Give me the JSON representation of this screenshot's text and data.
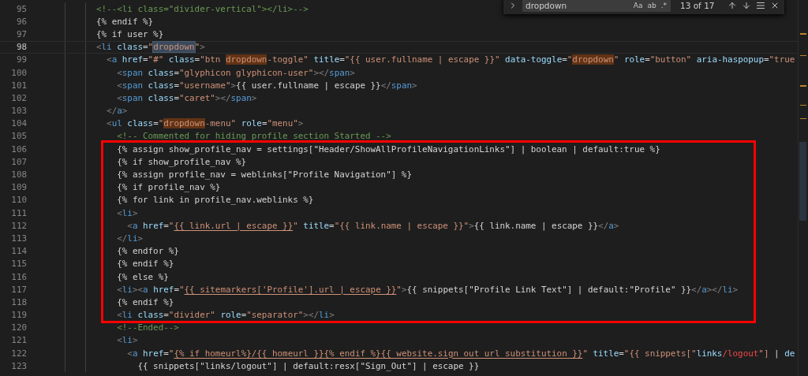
{
  "find_widget": {
    "query": "dropdown",
    "options": [
      {
        "label": "Aa",
        "on": false
      },
      {
        "label": "ab",
        "on": false
      },
      {
        "label": ".*",
        "on": false
      }
    ],
    "result": "13 of 17"
  },
  "lines": [
    {
      "number": "95",
      "current": false,
      "tokens": [
        {
          "kind": "cmt",
          "text": "<!--<li class=\"divider-vertical\"></li>-->"
        }
      ]
    },
    {
      "number": "96",
      "current": false,
      "tokens": [
        {
          "kind": "txt",
          "text": "{% endif %}"
        }
      ]
    },
    {
      "number": "97",
      "current": false,
      "tokens": [
        {
          "kind": "txt",
          "text": "{% if user %}"
        }
      ]
    },
    {
      "number": "98",
      "current": true,
      "tokens": [
        {
          "kind": "p",
          "text": "<"
        },
        {
          "kind": "tag",
          "text": "li"
        },
        {
          "kind": "attr",
          "text": " class"
        },
        {
          "kind": "txt",
          "text": "="
        },
        {
          "kind": "str",
          "text": "\""
        },
        {
          "kind": "cur",
          "text": "dropdown"
        },
        {
          "kind": "str",
          "text": "\""
        },
        {
          "kind": "p",
          "text": ">"
        }
      ]
    },
    {
      "number": "99",
      "current": false,
      "tokens": [
        {
          "kind": "p",
          "text": "  <"
        },
        {
          "kind": "tag",
          "text": "a"
        },
        {
          "kind": "attr",
          "text": " href"
        },
        {
          "kind": "txt",
          "text": "="
        },
        {
          "kind": "str",
          "text": "\"#\""
        },
        {
          "kind": "attr",
          "text": " class"
        },
        {
          "kind": "txt",
          "text": "="
        },
        {
          "kind": "str",
          "text": "\"btn "
        },
        {
          "kind": "hit",
          "text": "dropdown"
        },
        {
          "kind": "str",
          "text": "-toggle\""
        },
        {
          "kind": "attr",
          "text": " title"
        },
        {
          "kind": "txt",
          "text": "="
        },
        {
          "kind": "str",
          "text": "\"{{ user.fullname | escape }}\""
        },
        {
          "kind": "attr",
          "text": " data-toggle"
        },
        {
          "kind": "txt",
          "text": "="
        },
        {
          "kind": "str",
          "text": "\""
        },
        {
          "kind": "hit",
          "text": "dropdown"
        },
        {
          "kind": "str",
          "text": "\""
        },
        {
          "kind": "attr",
          "text": " role"
        },
        {
          "kind": "txt",
          "text": "="
        },
        {
          "kind": "str",
          "text": "\"button\""
        },
        {
          "kind": "attr",
          "text": " aria-haspopup"
        },
        {
          "kind": "txt",
          "text": "="
        },
        {
          "kind": "str",
          "text": "\"true"
        }
      ]
    },
    {
      "number": "100",
      "current": false,
      "tokens": [
        {
          "kind": "p",
          "text": "    <"
        },
        {
          "kind": "tag",
          "text": "span"
        },
        {
          "kind": "attr",
          "text": " class"
        },
        {
          "kind": "txt",
          "text": "="
        },
        {
          "kind": "str",
          "text": "\"glyphicon glyphicon-user\""
        },
        {
          "kind": "p",
          "text": "></"
        },
        {
          "kind": "tag",
          "text": "span"
        },
        {
          "kind": "p",
          "text": ">"
        }
      ]
    },
    {
      "number": "101",
      "current": false,
      "tokens": [
        {
          "kind": "p",
          "text": "    <"
        },
        {
          "kind": "tag",
          "text": "span"
        },
        {
          "kind": "attr",
          "text": " class"
        },
        {
          "kind": "txt",
          "text": "="
        },
        {
          "kind": "str",
          "text": "\"username\""
        },
        {
          "kind": "p",
          "text": ">"
        },
        {
          "kind": "txt",
          "text": "{{ user.fullname | escape }}"
        },
        {
          "kind": "p",
          "text": "</"
        },
        {
          "kind": "tag",
          "text": "span"
        },
        {
          "kind": "p",
          "text": ">"
        }
      ]
    },
    {
      "number": "102",
      "current": false,
      "tokens": [
        {
          "kind": "p",
          "text": "    <"
        },
        {
          "kind": "tag",
          "text": "span"
        },
        {
          "kind": "attr",
          "text": " class"
        },
        {
          "kind": "txt",
          "text": "="
        },
        {
          "kind": "str",
          "text": "\"caret\""
        },
        {
          "kind": "p",
          "text": "></"
        },
        {
          "kind": "tag",
          "text": "span"
        },
        {
          "kind": "p",
          "text": ">"
        }
      ]
    },
    {
      "number": "103",
      "current": false,
      "tokens": [
        {
          "kind": "p",
          "text": "  </"
        },
        {
          "kind": "tag",
          "text": "a"
        },
        {
          "kind": "p",
          "text": ">"
        }
      ]
    },
    {
      "number": "104",
      "current": false,
      "tokens": [
        {
          "kind": "p",
          "text": "  <"
        },
        {
          "kind": "tag",
          "text": "ul"
        },
        {
          "kind": "attr",
          "text": " class"
        },
        {
          "kind": "txt",
          "text": "="
        },
        {
          "kind": "str",
          "text": "\""
        },
        {
          "kind": "hit",
          "text": "dropdown"
        },
        {
          "kind": "str",
          "text": "-menu\""
        },
        {
          "kind": "attr",
          "text": " role"
        },
        {
          "kind": "txt",
          "text": "="
        },
        {
          "kind": "str",
          "text": "\"menu\""
        },
        {
          "kind": "p",
          "text": ">"
        }
      ]
    },
    {
      "number": "105",
      "current": false,
      "tokens": [
        {
          "kind": "cmt",
          "text": "    <!-- Commented for hiding profile section Started -->"
        }
      ]
    },
    {
      "number": "106",
      "current": false,
      "tokens": [
        {
          "kind": "txt",
          "text": "    {% assign show_profile_nav = settings[\"Header/ShowAllProfileNavigationLinks\"] | boolean | default:true %}"
        }
      ]
    },
    {
      "number": "107",
      "current": false,
      "tokens": [
        {
          "kind": "txt",
          "text": "    {% if show_profile_nav %}"
        }
      ]
    },
    {
      "number": "108",
      "current": false,
      "tokens": [
        {
          "kind": "txt",
          "text": "    {% assign profile_nav = weblinks[\"Profile Navigation\"] %}"
        }
      ]
    },
    {
      "number": "109",
      "current": false,
      "tokens": [
        {
          "kind": "txt",
          "text": "    {% if profile_nav %}"
        }
      ]
    },
    {
      "number": "110",
      "current": false,
      "tokens": [
        {
          "kind": "txt",
          "text": "    {% for link in profile_nav.weblinks %}"
        }
      ]
    },
    {
      "number": "111",
      "current": false,
      "tokens": [
        {
          "kind": "p",
          "text": "    <"
        },
        {
          "kind": "tag",
          "text": "li"
        },
        {
          "kind": "p",
          "text": ">"
        }
      ]
    },
    {
      "number": "112",
      "current": false,
      "tokens": [
        {
          "kind": "p",
          "text": "      <"
        },
        {
          "kind": "tag",
          "text": "a"
        },
        {
          "kind": "attr",
          "text": " href"
        },
        {
          "kind": "txt",
          "text": "="
        },
        {
          "kind": "str",
          "text": "\""
        },
        {
          "kind": "link",
          "text": "{{ link.url | escape }}"
        },
        {
          "kind": "str",
          "text": "\""
        },
        {
          "kind": "attr",
          "text": " title"
        },
        {
          "kind": "txt",
          "text": "="
        },
        {
          "kind": "str",
          "text": "\"{{ link.name | escape }}\""
        },
        {
          "kind": "p",
          "text": ">"
        },
        {
          "kind": "txt",
          "text": "{{ link.name | escape }}"
        },
        {
          "kind": "p",
          "text": "</"
        },
        {
          "kind": "tag",
          "text": "a"
        },
        {
          "kind": "p",
          "text": ">"
        }
      ]
    },
    {
      "number": "113",
      "current": false,
      "tokens": [
        {
          "kind": "p",
          "text": "    </"
        },
        {
          "kind": "tag",
          "text": "li"
        },
        {
          "kind": "p",
          "text": ">"
        }
      ]
    },
    {
      "number": "114",
      "current": false,
      "tokens": [
        {
          "kind": "txt",
          "text": "    {% endfor %}"
        }
      ]
    },
    {
      "number": "115",
      "current": false,
      "tokens": [
        {
          "kind": "txt",
          "text": "    {% endif %}"
        }
      ]
    },
    {
      "number": "116",
      "current": false,
      "tokens": [
        {
          "kind": "txt",
          "text": "    {% else %}"
        }
      ]
    },
    {
      "number": "117",
      "current": false,
      "tokens": [
        {
          "kind": "p",
          "text": "    <"
        },
        {
          "kind": "tag",
          "text": "li"
        },
        {
          "kind": "p",
          "text": "><"
        },
        {
          "kind": "tag",
          "text": "a"
        },
        {
          "kind": "attr",
          "text": " href"
        },
        {
          "kind": "txt",
          "text": "="
        },
        {
          "kind": "str",
          "text": "\""
        },
        {
          "kind": "link",
          "text": "{{ sitemarkers['Profile'].url | escape }}"
        },
        {
          "kind": "str",
          "text": "\""
        },
        {
          "kind": "p",
          "text": ">"
        },
        {
          "kind": "txt",
          "text": "{{ snippets[\"Profile Link Text\"] | default:\"Profile\" }}"
        },
        {
          "kind": "p",
          "text": "</"
        },
        {
          "kind": "tag",
          "text": "a"
        },
        {
          "kind": "p",
          "text": "></"
        },
        {
          "kind": "tag",
          "text": "li"
        },
        {
          "kind": "p",
          "text": ">"
        }
      ]
    },
    {
      "number": "118",
      "current": false,
      "tokens": [
        {
          "kind": "txt",
          "text": "    {% endif %}"
        }
      ]
    },
    {
      "number": "119",
      "current": false,
      "tokens": [
        {
          "kind": "p",
          "text": "    <"
        },
        {
          "kind": "tag",
          "text": "li"
        },
        {
          "kind": "attr",
          "text": " class"
        },
        {
          "kind": "txt",
          "text": "="
        },
        {
          "kind": "str",
          "text": "\"divider\""
        },
        {
          "kind": "attr",
          "text": " role"
        },
        {
          "kind": "txt",
          "text": "="
        },
        {
          "kind": "str",
          "text": "\"separator\""
        },
        {
          "kind": "p",
          "text": "></"
        },
        {
          "kind": "tag",
          "text": "li"
        },
        {
          "kind": "p",
          "text": ">"
        }
      ]
    },
    {
      "number": "120",
      "current": false,
      "tokens": [
        {
          "kind": "cmt",
          "text": "    <!--Ended-->"
        }
      ]
    },
    {
      "number": "121",
      "current": false,
      "tokens": [
        {
          "kind": "p",
          "text": "    <"
        },
        {
          "kind": "tag",
          "text": "li"
        },
        {
          "kind": "p",
          "text": ">"
        }
      ]
    },
    {
      "number": "122",
      "current": false,
      "tokens": [
        {
          "kind": "p",
          "text": "      <"
        },
        {
          "kind": "tag",
          "text": "a"
        },
        {
          "kind": "attr",
          "text": " href"
        },
        {
          "kind": "txt",
          "text": "="
        },
        {
          "kind": "str",
          "text": "\""
        },
        {
          "kind": "link",
          "text": "{% if homeurl%}/{{ homeurl }}{% endif %}{{ website.sign_out_url_substitution }}"
        },
        {
          "kind": "str",
          "text": "\""
        },
        {
          "kind": "attr",
          "text": " title"
        },
        {
          "kind": "txt",
          "text": "="
        },
        {
          "kind": "str",
          "text": "\"{{ snippets[\""
        },
        {
          "kind": "key",
          "text": "links"
        },
        {
          "kind": "red",
          "text": "/logout"
        },
        {
          "kind": "str",
          "text": "\"]"
        },
        {
          "kind": "txt",
          "text": " | "
        },
        {
          "kind": "key",
          "text": "de"
        }
      ]
    },
    {
      "number": "123",
      "current": false,
      "tokens": [
        {
          "kind": "txt",
          "text": "        {{ snippets[\"links/logout\"] | default:resx[\"Sign_Out\"] | escape }}"
        }
      ]
    }
  ]
}
